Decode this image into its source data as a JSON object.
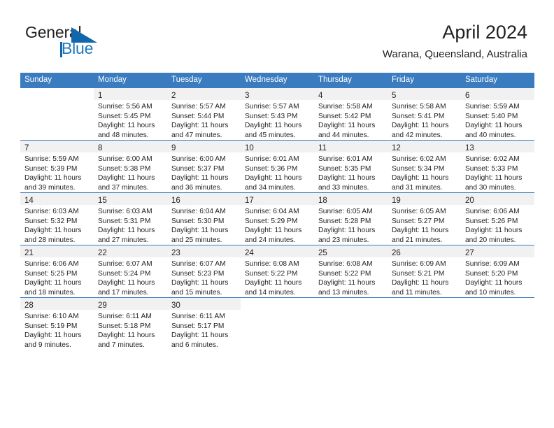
{
  "brand": {
    "name_part1": "General",
    "name_part2": "Blue",
    "triangle_icon": "triangle-icon",
    "accent_color": "#1266ab"
  },
  "header": {
    "month_title": "April 2024",
    "location": "Warana, Queensland, Australia"
  },
  "calendar": {
    "header_bg": "#3a7cbf",
    "daynum_band_bg": "#f1f1f1",
    "weekday_headers": [
      "Sunday",
      "Monday",
      "Tuesday",
      "Wednesday",
      "Thursday",
      "Friday",
      "Saturday"
    ],
    "weeks": [
      [
        {
          "day": "",
          "lines": []
        },
        {
          "day": "1",
          "lines": [
            "Sunrise: 5:56 AM",
            "Sunset: 5:45 PM",
            "Daylight: 11 hours",
            "and 48 minutes."
          ]
        },
        {
          "day": "2",
          "lines": [
            "Sunrise: 5:57 AM",
            "Sunset: 5:44 PM",
            "Daylight: 11 hours",
            "and 47 minutes."
          ]
        },
        {
          "day": "3",
          "lines": [
            "Sunrise: 5:57 AM",
            "Sunset: 5:43 PM",
            "Daylight: 11 hours",
            "and 45 minutes."
          ]
        },
        {
          "day": "4",
          "lines": [
            "Sunrise: 5:58 AM",
            "Sunset: 5:42 PM",
            "Daylight: 11 hours",
            "and 44 minutes."
          ]
        },
        {
          "day": "5",
          "lines": [
            "Sunrise: 5:58 AM",
            "Sunset: 5:41 PM",
            "Daylight: 11 hours",
            "and 42 minutes."
          ]
        },
        {
          "day": "6",
          "lines": [
            "Sunrise: 5:59 AM",
            "Sunset: 5:40 PM",
            "Daylight: 11 hours",
            "and 40 minutes."
          ]
        }
      ],
      [
        {
          "day": "7",
          "lines": [
            "Sunrise: 5:59 AM",
            "Sunset: 5:39 PM",
            "Daylight: 11 hours",
            "and 39 minutes."
          ]
        },
        {
          "day": "8",
          "lines": [
            "Sunrise: 6:00 AM",
            "Sunset: 5:38 PM",
            "Daylight: 11 hours",
            "and 37 minutes."
          ]
        },
        {
          "day": "9",
          "lines": [
            "Sunrise: 6:00 AM",
            "Sunset: 5:37 PM",
            "Daylight: 11 hours",
            "and 36 minutes."
          ]
        },
        {
          "day": "10",
          "lines": [
            "Sunrise: 6:01 AM",
            "Sunset: 5:36 PM",
            "Daylight: 11 hours",
            "and 34 minutes."
          ]
        },
        {
          "day": "11",
          "lines": [
            "Sunrise: 6:01 AM",
            "Sunset: 5:35 PM",
            "Daylight: 11 hours",
            "and 33 minutes."
          ]
        },
        {
          "day": "12",
          "lines": [
            "Sunrise: 6:02 AM",
            "Sunset: 5:34 PM",
            "Daylight: 11 hours",
            "and 31 minutes."
          ]
        },
        {
          "day": "13",
          "lines": [
            "Sunrise: 6:02 AM",
            "Sunset: 5:33 PM",
            "Daylight: 11 hours",
            "and 30 minutes."
          ]
        }
      ],
      [
        {
          "day": "14",
          "lines": [
            "Sunrise: 6:03 AM",
            "Sunset: 5:32 PM",
            "Daylight: 11 hours",
            "and 28 minutes."
          ]
        },
        {
          "day": "15",
          "lines": [
            "Sunrise: 6:03 AM",
            "Sunset: 5:31 PM",
            "Daylight: 11 hours",
            "and 27 minutes."
          ]
        },
        {
          "day": "16",
          "lines": [
            "Sunrise: 6:04 AM",
            "Sunset: 5:30 PM",
            "Daylight: 11 hours",
            "and 25 minutes."
          ]
        },
        {
          "day": "17",
          "lines": [
            "Sunrise: 6:04 AM",
            "Sunset: 5:29 PM",
            "Daylight: 11 hours",
            "and 24 minutes."
          ]
        },
        {
          "day": "18",
          "lines": [
            "Sunrise: 6:05 AM",
            "Sunset: 5:28 PM",
            "Daylight: 11 hours",
            "and 23 minutes."
          ]
        },
        {
          "day": "19",
          "lines": [
            "Sunrise: 6:05 AM",
            "Sunset: 5:27 PM",
            "Daylight: 11 hours",
            "and 21 minutes."
          ]
        },
        {
          "day": "20",
          "lines": [
            "Sunrise: 6:06 AM",
            "Sunset: 5:26 PM",
            "Daylight: 11 hours",
            "and 20 minutes."
          ]
        }
      ],
      [
        {
          "day": "21",
          "lines": [
            "Sunrise: 6:06 AM",
            "Sunset: 5:25 PM",
            "Daylight: 11 hours",
            "and 18 minutes."
          ]
        },
        {
          "day": "22",
          "lines": [
            "Sunrise: 6:07 AM",
            "Sunset: 5:24 PM",
            "Daylight: 11 hours",
            "and 17 minutes."
          ]
        },
        {
          "day": "23",
          "lines": [
            "Sunrise: 6:07 AM",
            "Sunset: 5:23 PM",
            "Daylight: 11 hours",
            "and 15 minutes."
          ]
        },
        {
          "day": "24",
          "lines": [
            "Sunrise: 6:08 AM",
            "Sunset: 5:22 PM",
            "Daylight: 11 hours",
            "and 14 minutes."
          ]
        },
        {
          "day": "25",
          "lines": [
            "Sunrise: 6:08 AM",
            "Sunset: 5:22 PM",
            "Daylight: 11 hours",
            "and 13 minutes."
          ]
        },
        {
          "day": "26",
          "lines": [
            "Sunrise: 6:09 AM",
            "Sunset: 5:21 PM",
            "Daylight: 11 hours",
            "and 11 minutes."
          ]
        },
        {
          "day": "27",
          "lines": [
            "Sunrise: 6:09 AM",
            "Sunset: 5:20 PM",
            "Daylight: 11 hours",
            "and 10 minutes."
          ]
        }
      ],
      [
        {
          "day": "28",
          "lines": [
            "Sunrise: 6:10 AM",
            "Sunset: 5:19 PM",
            "Daylight: 11 hours",
            "and 9 minutes."
          ]
        },
        {
          "day": "29",
          "lines": [
            "Sunrise: 6:11 AM",
            "Sunset: 5:18 PM",
            "Daylight: 11 hours",
            "and 7 minutes."
          ]
        },
        {
          "day": "30",
          "lines": [
            "Sunrise: 6:11 AM",
            "Sunset: 5:17 PM",
            "Daylight: 11 hours",
            "and 6 minutes."
          ]
        },
        {
          "day": "",
          "lines": []
        },
        {
          "day": "",
          "lines": []
        },
        {
          "day": "",
          "lines": []
        },
        {
          "day": "",
          "lines": []
        }
      ]
    ]
  }
}
